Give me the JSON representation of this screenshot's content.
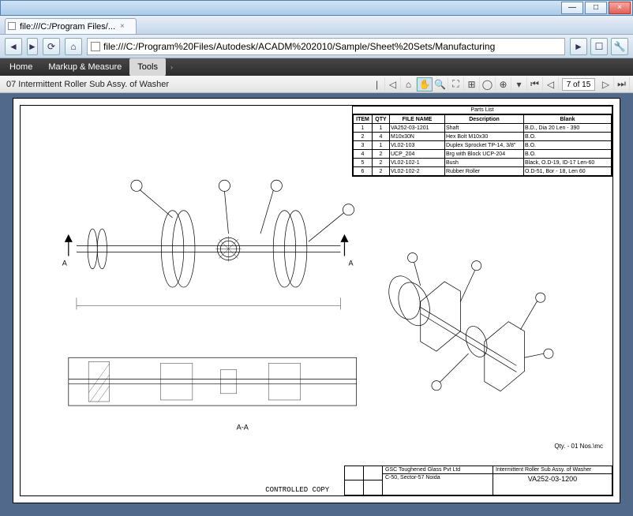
{
  "window": {
    "min": "—",
    "max": "□",
    "close": "×"
  },
  "tab": {
    "title": "file:///C:/Program Files/...",
    "close": "×"
  },
  "nav": {
    "back": "◄",
    "fwd": "►",
    "reload": "⟳",
    "home": "⌂",
    "url": "file:///C:/Program%20Files/Autodesk/ACADM%202010/Sample/Sheet%20Sets/Manufacturing",
    "go": "►",
    "feeds": "☐",
    "tools": "🔧"
  },
  "appmenu": {
    "home": "Home",
    "markup": "Markup & Measure",
    "tools": "Tools",
    "hidden": ""
  },
  "doc": {
    "title": "07 Intermittent Roller Sub Assy. of Washer",
    "page": "7 of 15"
  },
  "parts": {
    "title": "Parts List",
    "headers": [
      "ITEM",
      "QTY",
      "FILE NAME",
      "Description",
      "Blank"
    ],
    "rows": [
      [
        "1",
        "1",
        "VA252-03-1201",
        "Shaft",
        "B.D., Dia 20 Len - 390"
      ],
      [
        "2",
        "4",
        "M10x30N",
        "Hex Bolt M10x30",
        "B.O."
      ],
      [
        "3",
        "1",
        "VL02-103",
        "Duplex Sprocket TP-14, 3/8\"",
        "B.O."
      ],
      [
        "4",
        "2",
        "UCP_204",
        "Brg with Block UCP-204",
        "B.O."
      ],
      [
        "5",
        "2",
        "VL02-102-1",
        "Bush",
        "Black, O.D-19, ID-17 Len-60"
      ],
      [
        "6",
        "2",
        "VL02-102-2",
        "Rubber Roller",
        "O.D-51, Bor - 18, Len 60"
      ]
    ]
  },
  "titleblock": {
    "company": "GSC Toughened Glass Pvt Ltd",
    "address": "C-50, Sector-57 Noida",
    "name": "Intermittent Roller Sub Assy. of Washer",
    "number": "VA252-03-1200"
  },
  "notes": {
    "controlled": "CONTROLLED COPY",
    "qty": "Qty. - 01 Nos.\\mc",
    "sectA": "A",
    "sectAA": "A-A"
  }
}
